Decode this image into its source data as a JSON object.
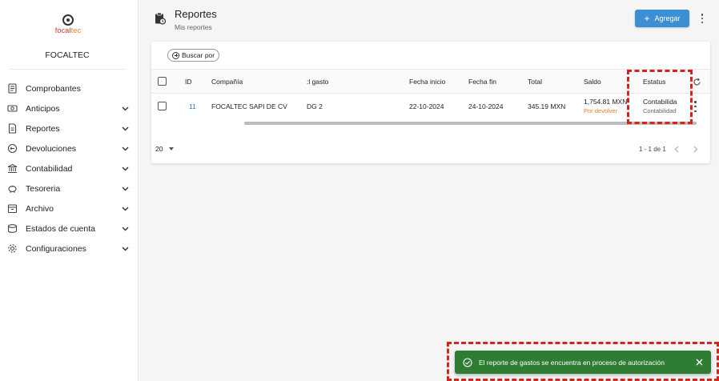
{
  "brand": {
    "logo_text_a": "focal",
    "logo_text_b": "tec",
    "org_name": "FOCALTEC",
    "logo_color": "#c0392b",
    "logo_accent": "#e67e22"
  },
  "sidebar": {
    "items": [
      {
        "label": "Comprobantes",
        "icon": "receipt-icon",
        "expandable": false
      },
      {
        "label": "Anticipos",
        "icon": "cash-icon",
        "expandable": true
      },
      {
        "label": "Reportes",
        "icon": "report-icon",
        "expandable": true
      },
      {
        "label": "Devoluciones",
        "icon": "refund-icon",
        "expandable": true
      },
      {
        "label": "Contabilidad",
        "icon": "bank-icon",
        "expandable": true
      },
      {
        "label": "Tesoreria",
        "icon": "piggy-bank-icon",
        "expandable": true
      },
      {
        "label": "Archivo",
        "icon": "archive-icon",
        "expandable": true
      },
      {
        "label": "Estados de cuenta",
        "icon": "account-statement-icon",
        "expandable": true
      },
      {
        "label": "Configuraciones",
        "icon": "gear-icon",
        "expandable": true
      }
    ]
  },
  "header": {
    "title": "Reportes",
    "subtitle": "Mis reportes",
    "add_button": "Agregar",
    "accent_color": "#3d8fd3"
  },
  "filters": {
    "search_chip": "Buscar por"
  },
  "table": {
    "columns": [
      "ID",
      "Compañía",
      ":l gasto",
      "Fecha inicio",
      "Fecha fin",
      "Total",
      "Saldo",
      "Estatus"
    ],
    "rows": [
      {
        "id": "11",
        "company": "FOCALTEC SAPI DE CV",
        "expense": "DG 2",
        "start_date": "22-10-2024",
        "end_date": "24-10-2024",
        "total": "345.19 MXN",
        "balance": "1,754.81 MXN",
        "balance_status": "Por devolver",
        "status": "Contabilida",
        "status_sub": "Contabilidad"
      }
    ]
  },
  "pagination": {
    "page_size": "20",
    "range": "1 - 1 de 1"
  },
  "toast": {
    "message": "El reporte de gastos se encuentra en proceso de autorización",
    "color": "#2e7d32"
  }
}
